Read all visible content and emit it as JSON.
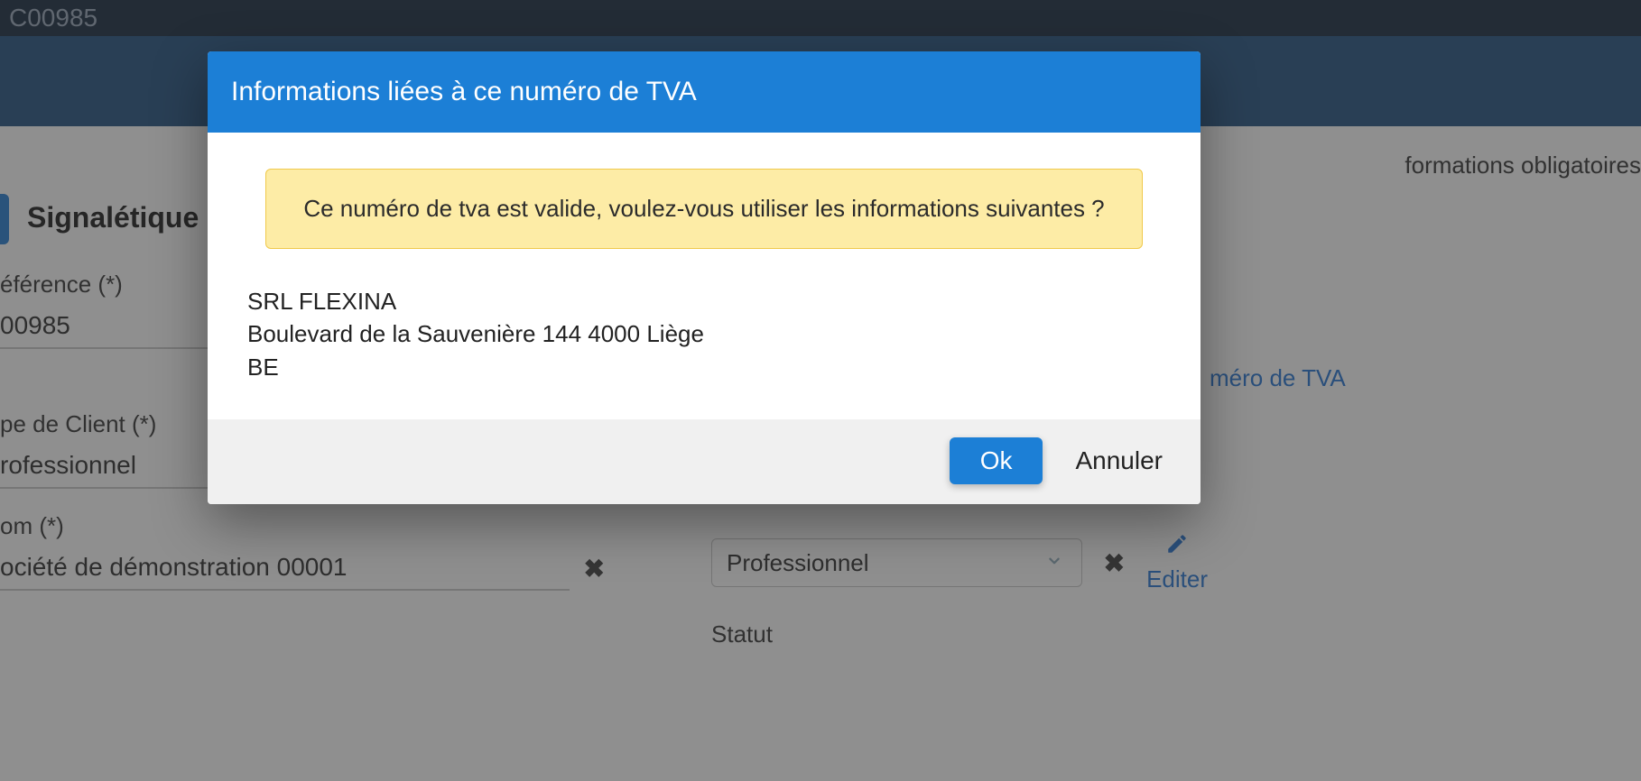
{
  "top": {
    "code": "C00985"
  },
  "notes": {
    "required": "formations obligatoires"
  },
  "section": {
    "title": "Signalétique"
  },
  "fields": {
    "reference": {
      "label": "éférence (*)",
      "value": "00985"
    },
    "client_type": {
      "label": "pe de Client (*)",
      "value": "rofessionnel"
    },
    "name": {
      "label": "om (*)",
      "value": "ociété de démonstration 00001"
    },
    "right_input": {
      "value": ""
    },
    "vat_link": {
      "label": "méro de TVA"
    },
    "category_select": {
      "value": "Professionnel"
    },
    "statut": {
      "label": "Statut"
    },
    "edit": {
      "label": "Editer"
    }
  },
  "modal": {
    "title": "Informations liées à ce numéro de TVA",
    "alert": "Ce numéro de tva est valide, voulez-vous utiliser les informations suivantes ?",
    "company": "SRL FLEXINA",
    "address": "Boulevard de la Sauvenière 144 4000 Liège",
    "country": "BE",
    "ok": "Ok",
    "cancel": "Annuler"
  }
}
